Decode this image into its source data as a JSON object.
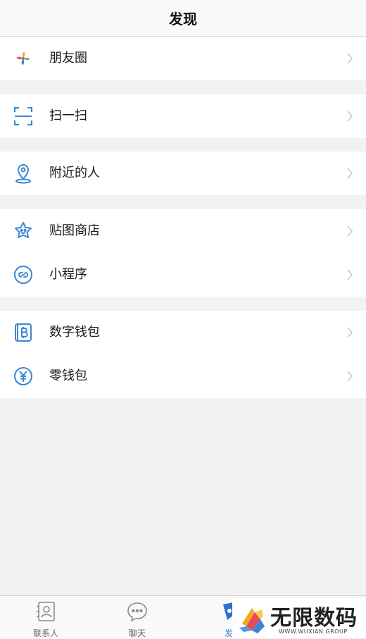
{
  "header": {
    "title": "发现"
  },
  "groups": [
    {
      "items": [
        {
          "label": "朋友圈",
          "icon": "moments-pinwheel-icon"
        }
      ]
    },
    {
      "items": [
        {
          "label": "扫一扫",
          "icon": "scan-icon"
        }
      ]
    },
    {
      "items": [
        {
          "label": "附近的人",
          "icon": "location-pin-icon"
        }
      ]
    },
    {
      "items": [
        {
          "label": "贴图商店",
          "icon": "sticker-star-icon"
        },
        {
          "label": "小程序",
          "icon": "mini-program-icon"
        }
      ]
    },
    {
      "items": [
        {
          "label": "数字钱包",
          "icon": "bitcoin-wallet-icon"
        },
        {
          "label": "零钱包",
          "icon": "yen-coin-icon"
        }
      ]
    }
  ],
  "tabbar": {
    "tabs": [
      {
        "label": "联系人",
        "icon": "contacts-icon",
        "active": false
      },
      {
        "label": "聊天",
        "icon": "chat-bubble-icon",
        "active": false
      },
      {
        "label": "发",
        "icon": "discover-icon",
        "active": true
      }
    ]
  },
  "watermark": {
    "title": "无限数码",
    "subtitle": "WWW.WUXIAN.GROUP"
  },
  "colors": {
    "accent": "#3b7fd6",
    "background": "#f2f2f3",
    "icon_blue": "#3a86d4"
  }
}
